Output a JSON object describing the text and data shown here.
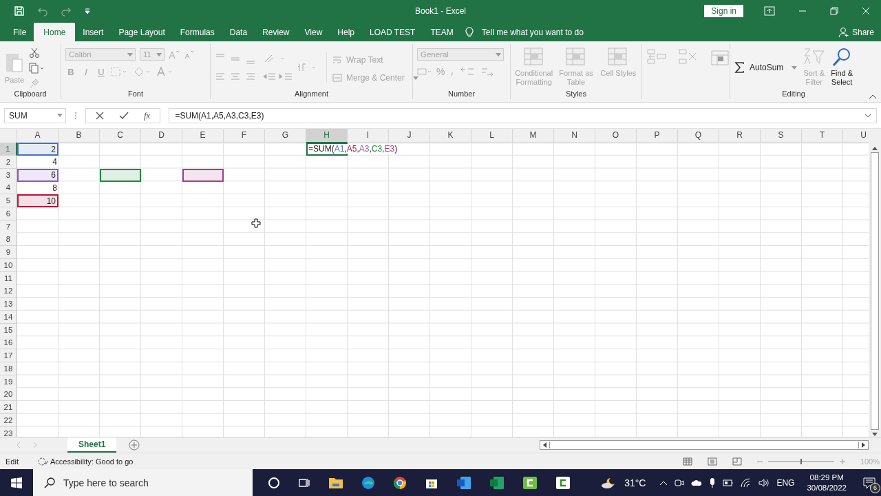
{
  "window": {
    "title": "Book1  -  Excel",
    "sign_in": "Sign in"
  },
  "ribbon_tabs": [
    {
      "label": "File",
      "selected": false
    },
    {
      "label": "Home",
      "selected": true
    },
    {
      "label": "Insert",
      "selected": false
    },
    {
      "label": "Page Layout",
      "selected": false
    },
    {
      "label": "Formulas",
      "selected": false
    },
    {
      "label": "Data",
      "selected": false
    },
    {
      "label": "Review",
      "selected": false
    },
    {
      "label": "View",
      "selected": false
    },
    {
      "label": "Help",
      "selected": false
    },
    {
      "label": "LOAD TEST",
      "selected": false
    },
    {
      "label": "TEAM",
      "selected": false
    }
  ],
  "tell_me": "Tell me what you want to do",
  "share": "Share",
  "ribbon_groups": [
    {
      "kind": "clipboard",
      "label": "Clipboard",
      "buttons": [
        {
          "label": "Paste",
          "disabled": true
        }
      ]
    },
    {
      "kind": "font",
      "label": "Font",
      "font_name": "Calibri",
      "font_size": "11",
      "styles": [
        "B",
        "I",
        "U"
      ],
      "disabled": true
    },
    {
      "kind": "alignment",
      "label": "Alignment",
      "buttons": [
        {
          "label": "Wrap Text",
          "disabled": true
        },
        {
          "label": "Merge & Center",
          "disabled": true
        }
      ]
    },
    {
      "kind": "number",
      "label": "Number",
      "format": "General",
      "percent": "%",
      "disabled": true
    },
    {
      "kind": "styles",
      "label": "Styles",
      "buttons": [
        {
          "label": "Conditional Formatting",
          "disabled": true
        },
        {
          "label": "Format as Table",
          "disabled": true
        },
        {
          "label": "Cell Styles",
          "disabled": true
        }
      ]
    },
    {
      "kind": "cells"
    },
    {
      "kind": "editing",
      "label": "Editing",
      "buttons": [
        {
          "label": "AutoSum",
          "disabled": false
        },
        {
          "label": "Sort & Filter",
          "disabled": true
        },
        {
          "label": "Find & Select",
          "disabled": false
        }
      ]
    }
  ],
  "formula_bar": {
    "name_box": "SUM",
    "fx": "fx",
    "formula": "=SUM(A1,A5,A3,C3,E3)"
  },
  "sheet": {
    "columns": [
      {
        "label": "A",
        "selected": false
      },
      {
        "label": "B",
        "selected": false
      },
      {
        "label": "C",
        "selected": false
      },
      {
        "label": "D",
        "selected": false
      },
      {
        "label": "E",
        "selected": false
      },
      {
        "label": "F",
        "selected": false
      },
      {
        "label": "G",
        "selected": false
      },
      {
        "label": "H",
        "selected": true
      },
      {
        "label": "I",
        "selected": false
      },
      {
        "label": "J",
        "selected": false
      },
      {
        "label": "K",
        "selected": false
      },
      {
        "label": "L",
        "selected": false
      },
      {
        "label": "M",
        "selected": false
      },
      {
        "label": "N",
        "selected": false
      },
      {
        "label": "O",
        "selected": false
      },
      {
        "label": "P",
        "selected": false
      },
      {
        "label": "Q",
        "selected": false
      },
      {
        "label": "R",
        "selected": false
      },
      {
        "label": "S",
        "selected": false
      },
      {
        "label": "T",
        "selected": false
      },
      {
        "label": "U",
        "selected": false
      }
    ],
    "rows": [
      {
        "label": "1",
        "selected": true,
        "cells": [
          {
            "value": "2",
            "color": "#4472c4"
          },
          null,
          null,
          null,
          null,
          null,
          null,
          {
            "active": true,
            "parts": [
              {
                "text": "=SUM("
              },
              {
                "text": "A1",
                "color": "#4472c4"
              },
              {
                "text": ","
              },
              {
                "text": "A5",
                "color": "#b4183c"
              },
              {
                "text": ","
              },
              {
                "text": "A3",
                "color": "#8a55c8"
              },
              {
                "text": ","
              },
              {
                "text": "C3",
                "color": "#1e8c3a"
              },
              {
                "text": ","
              },
              {
                "text": "E3",
                "color": "#a83c84"
              },
              {
                "text": ")"
              }
            ]
          }
        ]
      },
      {
        "label": "2",
        "selected": false,
        "cells": [
          {
            "value": "4"
          }
        ]
      },
      {
        "label": "3",
        "selected": false,
        "cells": [
          {
            "value": "6",
            "color": "#8a55c8"
          },
          null,
          {
            "color": "#1e8c3a"
          },
          null,
          {
            "color": "#a83c84"
          }
        ]
      },
      {
        "label": "4",
        "selected": false,
        "cells": [
          {
            "value": "8"
          }
        ]
      },
      {
        "label": "5",
        "selected": false,
        "cells": [
          {
            "value": "10",
            "color": "#b4183c"
          }
        ]
      },
      {
        "label": "6",
        "selected": false
      },
      {
        "label": "7",
        "selected": false
      },
      {
        "label": "8",
        "selected": false
      },
      {
        "label": "9",
        "selected": false
      },
      {
        "label": "10",
        "selected": false
      },
      {
        "label": "11",
        "selected": false
      },
      {
        "label": "12",
        "selected": false
      },
      {
        "label": "13",
        "selected": false
      },
      {
        "label": "14",
        "selected": false
      },
      {
        "label": "15",
        "selected": false
      },
      {
        "label": "16",
        "selected": false
      },
      {
        "label": "17",
        "selected": false
      },
      {
        "label": "18",
        "selected": false
      },
      {
        "label": "19",
        "selected": false
      },
      {
        "label": "20",
        "selected": false
      },
      {
        "label": "21",
        "selected": false
      },
      {
        "label": "22",
        "selected": false
      },
      {
        "label": "23",
        "selected": false
      }
    ]
  },
  "sheet_tabs": [
    {
      "label": "Sheet1",
      "selected": true
    }
  ],
  "status_bar": {
    "mode": "Edit",
    "accessibility": "Accessibility: Good to go",
    "zoom": "100%",
    "zoom_slider": {
      "level": 0.5
    }
  },
  "taskbar": {
    "search_placeholder": "Type here to search",
    "temperature": "31°C",
    "language": "ENG",
    "time": "08:29 PM",
    "date": "30/08/2022",
    "notifications": "6"
  }
}
